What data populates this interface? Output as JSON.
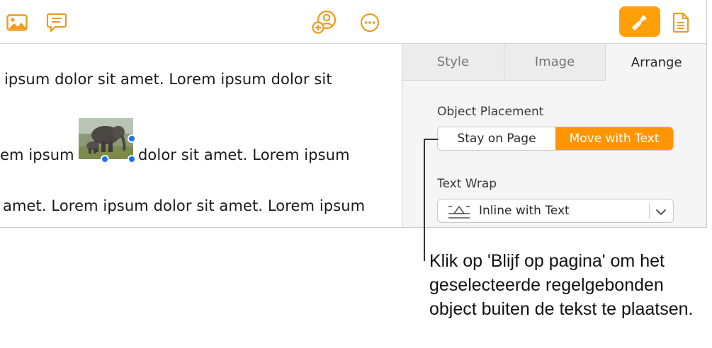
{
  "toolbar": {
    "icons": [
      "media-icon",
      "comment-icon",
      "collaborate-icon",
      "more-icon",
      "format-brush-icon",
      "document-icon"
    ],
    "accent": "#ff9f0a"
  },
  "document": {
    "lines": [
      "ipsum dolor sit amet.  Lorem ipsum dolor sit",
      "em ipsum",
      "dolor sit amet. Lorem ipsum",
      "amet. Lorem ipsum dolor sit amet. Lorem ipsum"
    ],
    "image": "elephant-photo"
  },
  "sidebar": {
    "tabs": [
      {
        "label": "Style"
      },
      {
        "label": "Image"
      },
      {
        "label": "Arrange"
      }
    ],
    "active_tab": "Arrange",
    "object_placement": {
      "title": "Object Placement",
      "options": [
        "Stay on Page",
        "Move with Text"
      ],
      "selected": "Move with Text",
      "selected_color": "#ff9500"
    },
    "text_wrap": {
      "title": "Text Wrap",
      "value": "Inline with Text"
    }
  },
  "callout": {
    "text": "Klik op 'Blijf op pagina' om het geselecteerde regelgebonden object buiten de tekst te plaatsen."
  }
}
